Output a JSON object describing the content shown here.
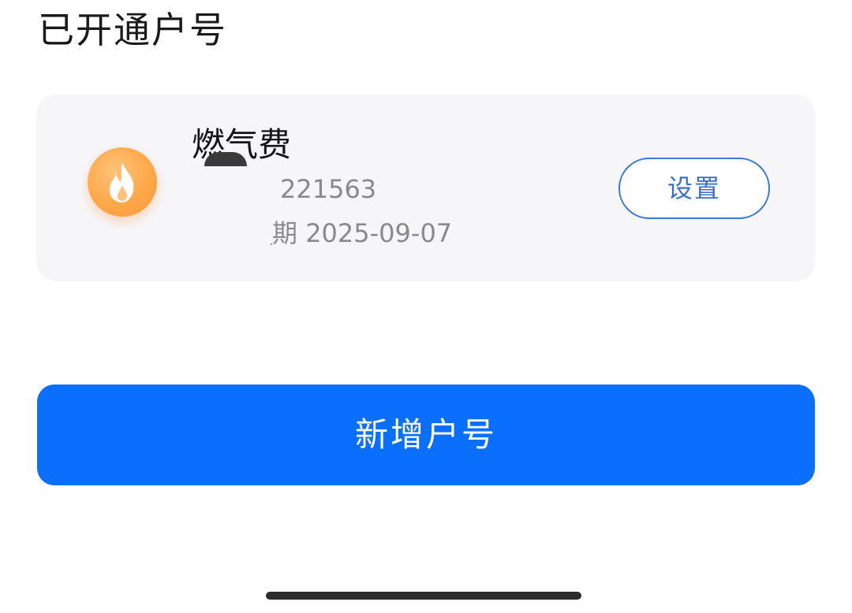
{
  "section": {
    "title": "已开通户号"
  },
  "account_card": {
    "icon": "flame-icon",
    "icon_color": "#ffa84a",
    "bill_type": "燃气费",
    "account_number": "221563",
    "expire_prefix": "期",
    "expire_date": "2025-09-07",
    "settings_label": "设置"
  },
  "actions": {
    "add_account_label": "新增户号"
  },
  "colors": {
    "primary": "#0a6ffd",
    "outline_button": "#3b78d8",
    "card_bg": "#f6f6f9"
  }
}
